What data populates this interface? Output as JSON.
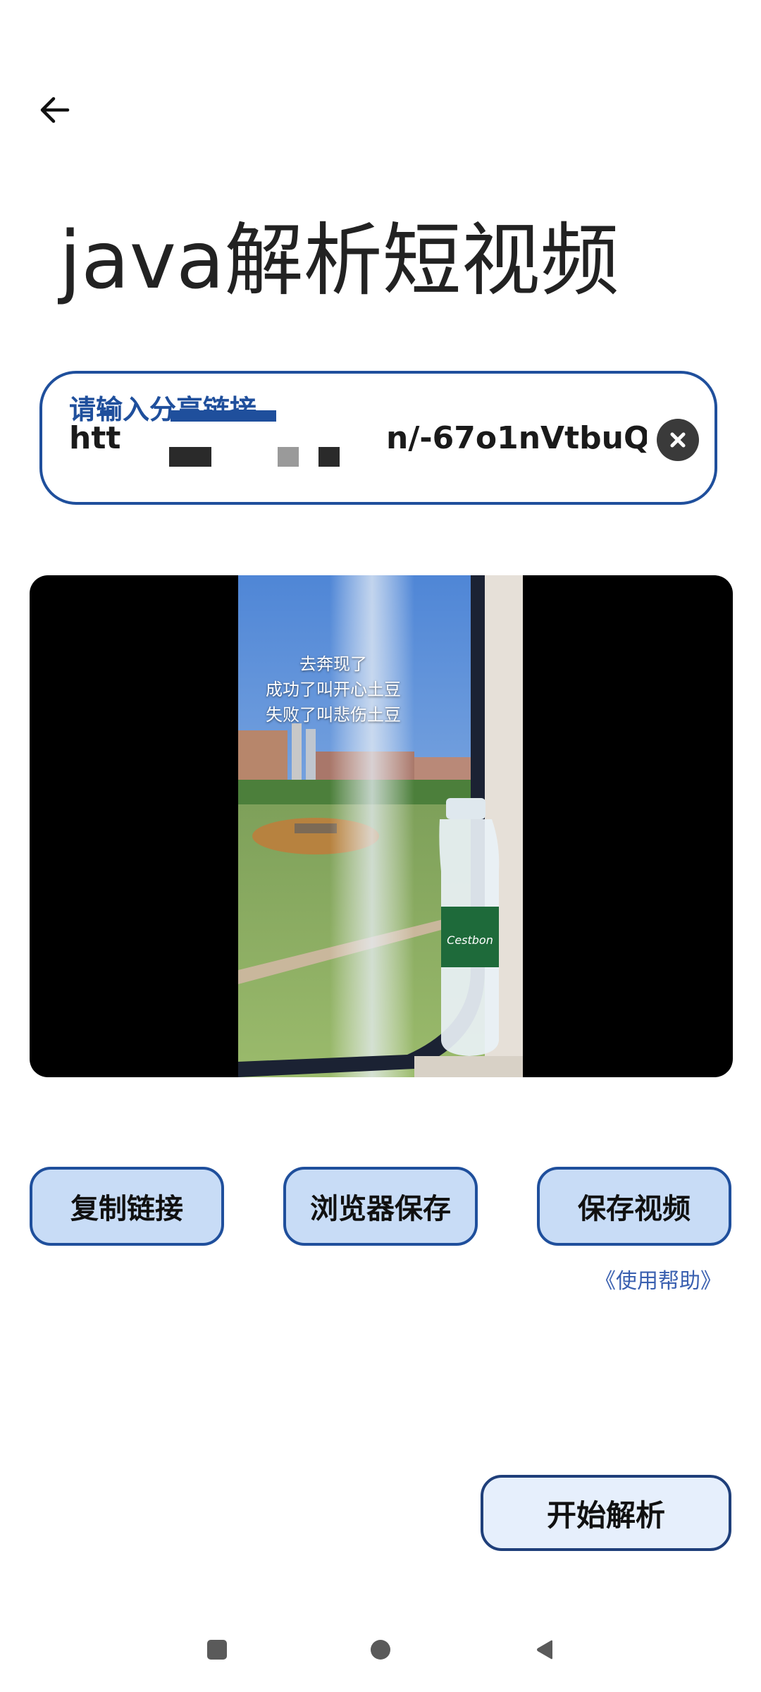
{
  "header": {
    "back_icon": "arrow-left-icon",
    "title": "java解析短视频"
  },
  "input": {
    "label": "请输入分享链接",
    "value_start": "htt",
    "value_end": "n/-67o1nVtbuQ/",
    "clear_icon": "close-circle-icon"
  },
  "video": {
    "caption_lines": [
      "去奔现了",
      "成功了叫开心土豆",
      "失败了叫悲伤土豆"
    ],
    "bottle_label": "Cestbon"
  },
  "actions": {
    "copy_label": "复制链接",
    "browser_save_label": "浏览器保存",
    "save_video_label": "保存视频"
  },
  "help_link": "《使用帮助》",
  "start_label": "开始解析",
  "colors": {
    "accent": "#1f4f9c",
    "button_fill": "#c8dcf6",
    "start_fill": "#e6effc",
    "help_link": "#3a60b0"
  },
  "nav": {
    "recent_icon": "square-icon",
    "home_icon": "circle-icon",
    "back_icon": "triangle-back-icon"
  }
}
